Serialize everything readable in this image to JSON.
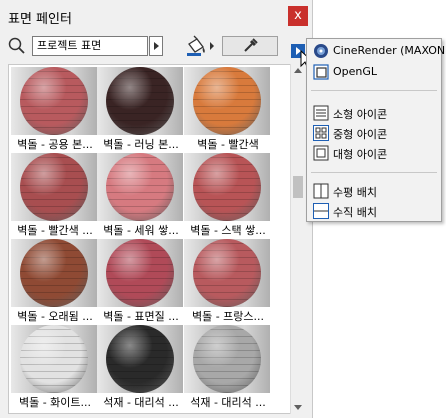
{
  "window": {
    "title": "표면 페인터",
    "close_label": "x"
  },
  "search": {
    "value": "프로젝트 표면"
  },
  "materials": [
    {
      "label": "벽돌 - 공용 본...",
      "color": "#b85a5e"
    },
    {
      "label": "벽돌 - 러닝 본...",
      "color": "#3a2424"
    },
    {
      "label": "벽돌 - 빨간색",
      "color": "#d87a3c"
    },
    {
      "label": "벽돌 - 빨간색 ...",
      "color": "#a84e50"
    },
    {
      "label": "벽돌 - 세워 쌓...",
      "color": "#d67a80"
    },
    {
      "label": "벽돌 - 스택 쌓...",
      "color": "#b85456"
    },
    {
      "label": "벽돌 - 오래됨 ...",
      "color": "#8f4a34"
    },
    {
      "label": "벽돌 - 표면질 ...",
      "color": "#b04a58"
    },
    {
      "label": "벽돌 - 프랑스...",
      "color": "#b85a5e"
    },
    {
      "label": "벽돌 - 화이트...",
      "color": "#e2e2e2"
    },
    {
      "label": "석재 - 대리석 ...",
      "color": "#2a2a2a"
    },
    {
      "label": "석재 - 대리석 ...",
      "color": "#a8a8a8"
    }
  ],
  "menu": {
    "items": [
      {
        "label": "CineRender (MAXON)",
        "icon": "cinerender-icon"
      },
      {
        "label": "OpenGL",
        "icon": "opengl-icon"
      },
      {
        "label": "소형 아이콘",
        "icon": "small-icons-icon"
      },
      {
        "label": "중형 아이콘",
        "icon": "medium-icons-icon"
      },
      {
        "label": "대형 아이콘",
        "icon": "large-icons-icon"
      },
      {
        "label": "수평 배치",
        "icon": "horizontal-layout-icon"
      },
      {
        "label": "수직 배치",
        "icon": "vertical-layout-icon"
      }
    ]
  },
  "colors": {
    "accent": "#1e5fb4",
    "close": "#c9302c"
  }
}
